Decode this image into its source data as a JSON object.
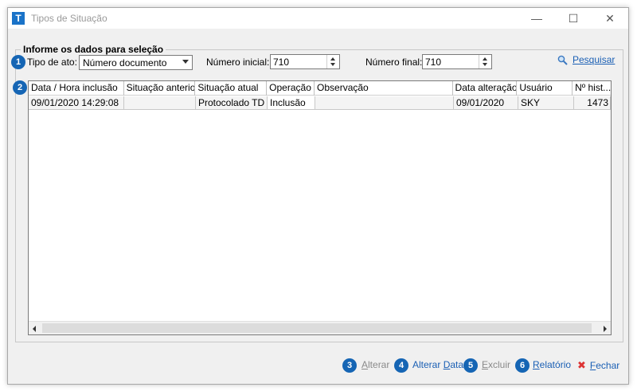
{
  "window": {
    "title": "Tipos de Situação",
    "app_icon_letter": "T",
    "minimize_glyph": "—",
    "maximize_glyph": "☐",
    "close_glyph": "✕"
  },
  "filter": {
    "group_title": "Informe os dados para seleção",
    "badge": "1",
    "tipo_ato_label": "Tipo de ato:",
    "tipo_ato_value": "Número documento",
    "numero_inicial_label": "Número inicial:",
    "numero_inicial_value": "710",
    "numero_final_label": "Número final:",
    "numero_final_value": "710",
    "search_label": "Pesquisar",
    "search_icon": "magnifier-icon"
  },
  "grid": {
    "badge": "2",
    "columns": [
      "Data / Hora inclusão",
      "Situação anterior",
      "Situação atual",
      "Operação",
      "Observação",
      "Data alteração",
      "Usuário",
      "Nº hist..."
    ],
    "rows": [
      [
        "09/01/2020 14:29:08",
        "",
        "Protocolado TD",
        "Inclusão",
        "",
        "09/01/2020",
        "SKY",
        "1473"
      ]
    ]
  },
  "footer": {
    "alterar": {
      "badge": "3",
      "label": "Alterar",
      "mnemonic": "A",
      "rest": "lterar"
    },
    "alterar_data": {
      "badge": "4",
      "label": "Alterar Data",
      "prefix": "Alterar ",
      "mnemonic": "D",
      "rest": "ata"
    },
    "excluir": {
      "badge": "5",
      "label": "Excluir",
      "mnemonic": "E",
      "rest": "xcluir"
    },
    "relatorio": {
      "badge": "6",
      "label": "Relatório",
      "mnemonic": "R",
      "rest": "elatório"
    },
    "fechar": {
      "label": "Fechar",
      "mnemonic": "F",
      "rest": "echar"
    }
  },
  "colors": {
    "badge": "#1565b4",
    "link": "#1a5fb4",
    "close_icon": "#dd3333"
  }
}
